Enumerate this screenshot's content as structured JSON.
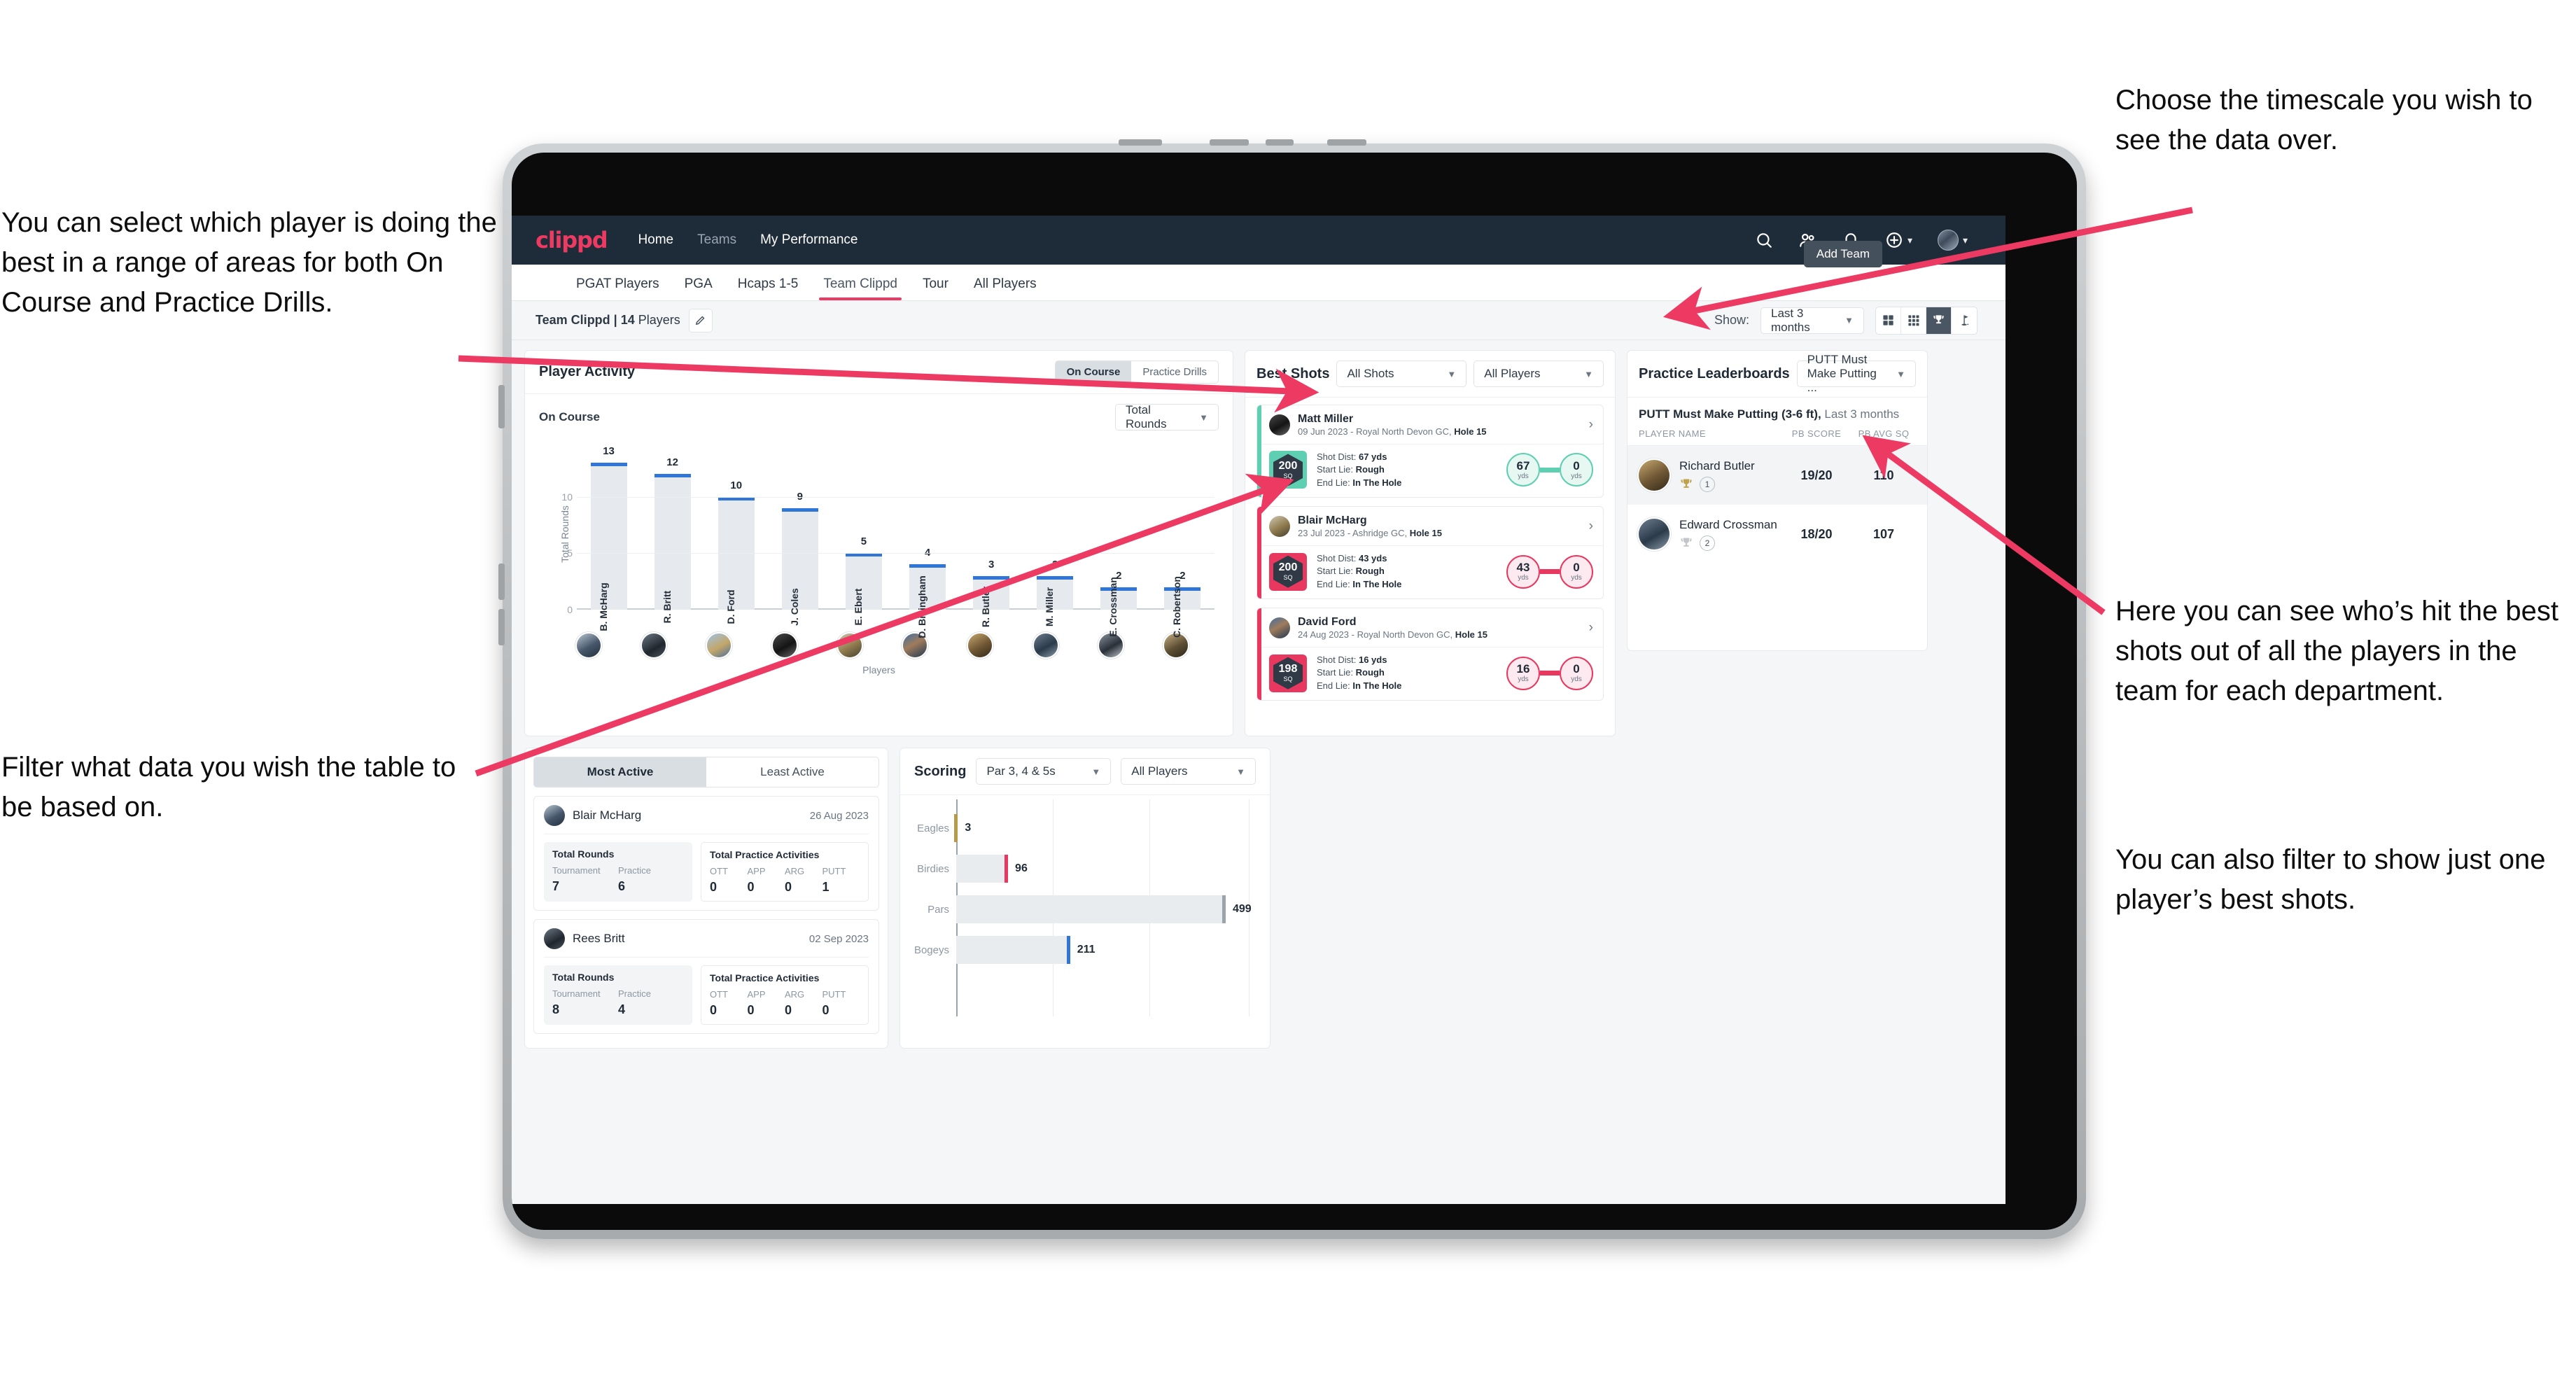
{
  "annotations": {
    "left_top": "You can select which player is doing the best in a range of areas for both On Course and Practice Drills.",
    "left_bottom": "Filter what data you wish the table to be based on.",
    "right_top": "Choose the timescale you wish to see the data over.",
    "right_mid": "Here you can see who’s hit the best shots out of all the players in the team for each department.",
    "right_bottom": "You can also filter to show just one player’s best shots."
  },
  "app": {
    "brand": "clippd",
    "nav_links": [
      {
        "label": "Home",
        "active": true
      },
      {
        "label": "Teams",
        "active": false
      },
      {
        "label": "My Performance",
        "active": true
      }
    ],
    "nav_icons": [
      "search-icon",
      "people-icon",
      "bell-icon",
      "plus-circle-icon",
      "avatar"
    ],
    "tabs": [
      {
        "label": "PGAT Players",
        "active": false
      },
      {
        "label": "PGA",
        "active": false
      },
      {
        "label": "Hcaps 1-5",
        "active": false
      },
      {
        "label": "Team Clippd",
        "active": true
      },
      {
        "label": "Tour",
        "active": false
      },
      {
        "label": "All Players",
        "active": false
      }
    ],
    "add_team_tooltip": "Add Team",
    "team_label_bold": "Team Clippd | 14",
    "team_label_rest": " Players",
    "show_label": "Show:",
    "show_value": "Last 3 months",
    "view_toggles": [
      {
        "icon": "grid-4-icon",
        "active": false
      },
      {
        "icon": "grid-9-icon",
        "active": false
      },
      {
        "icon": "trophy-icon",
        "active": true
      },
      {
        "icon": "golf-flag-icon",
        "active": false
      }
    ]
  },
  "player_activity": {
    "title": "Player Activity",
    "segments": [
      {
        "label": "On Course",
        "active": true
      },
      {
        "label": "Practice Drills",
        "active": false
      }
    ],
    "sub_label": "On Course",
    "metric_select": "Total Rounds",
    "x_axis_label": "Players"
  },
  "best_shots": {
    "title": "Best Shots",
    "filter_shots": "All Shots",
    "filter_players": "All Players",
    "shots": [
      {
        "player": "Matt Miller",
        "meta_plain": "09 Jun 2023 - Royal North Devon GC, ",
        "meta_bold": "Hole 15",
        "badge_value": "200",
        "badge_unit": "SQ",
        "shot_dist_label": "Shot Dist: ",
        "shot_dist": "67 yds",
        "start_lie_label": "Start Lie: ",
        "start_lie": "Rough",
        "end_lie_label": "End Lie: ",
        "end_lie": "In The Hole",
        "from_value": "67",
        "from_unit": "yds",
        "to_value": "0",
        "to_unit": "yds",
        "accent": "#5ecfb1"
      },
      {
        "player": "Blair McHarg",
        "meta_plain": "23 Jul 2023 - Ashridge GC, ",
        "meta_bold": "Hole 15",
        "badge_value": "200",
        "badge_unit": "SQ",
        "shot_dist_label": "Shot Dist: ",
        "shot_dist": "43 yds",
        "start_lie_label": "Start Lie: ",
        "start_lie": "Rough",
        "end_lie_label": "End Lie: ",
        "end_lie": "In The Hole",
        "from_value": "43",
        "from_unit": "yds",
        "to_value": "0",
        "to_unit": "yds",
        "accent": "#e8385f"
      },
      {
        "player": "David Ford",
        "meta_plain": "24 Aug 2023 - Royal North Devon GC, ",
        "meta_bold": "Hole 15",
        "badge_value": "198",
        "badge_unit": "SQ",
        "shot_dist_label": "Shot Dist: ",
        "shot_dist": "16 yds",
        "start_lie_label": "Start Lie: ",
        "start_lie": "Rough",
        "end_lie_label": "End Lie: ",
        "end_lie": "In The Hole",
        "from_value": "16",
        "from_unit": "yds",
        "to_value": "0",
        "to_unit": "yds",
        "accent": "#e8385f"
      }
    ]
  },
  "practice_leaderboards": {
    "title": "Practice Leaderboards",
    "drill_select": "PUTT Must Make Putting ...",
    "subtitle_bold": "PUTT Must Make Putting (3-6 ft),",
    "subtitle_rest": " Last 3 months",
    "columns": [
      "PLAYER NAME",
      "PB SCORE",
      "PB AVG SQ"
    ],
    "rows": [
      {
        "name": "Richard Butler",
        "rank": "1",
        "medal": "gold",
        "pb_score": "19/20",
        "pb_avg_sq": "110"
      },
      {
        "name": "Edward Crossman",
        "rank": "2",
        "medal": "silver",
        "pb_score": "18/20",
        "pb_avg_sq": "107"
      }
    ]
  },
  "activity_panel": {
    "tabs": [
      {
        "label": "Most Active",
        "active": true
      },
      {
        "label": "Least Active",
        "active": false
      }
    ],
    "rounds_title": "Total Rounds",
    "practice_title": "Total Practice Activities",
    "rounds_cols": [
      "Tournament",
      "Practice"
    ],
    "practice_cols": [
      "OTT",
      "APP",
      "ARG",
      "PUTT"
    ],
    "entries": [
      {
        "name": "Blair McHarg",
        "date": "26 Aug 2023",
        "tournament": "7",
        "practice": "6",
        "ott": "0",
        "app": "0",
        "arg": "0",
        "putt": "1"
      },
      {
        "name": "Rees Britt",
        "date": "02 Sep 2023",
        "tournament": "8",
        "practice": "4",
        "ott": "0",
        "app": "0",
        "arg": "0",
        "putt": "0"
      }
    ]
  },
  "scoring": {
    "title": "Scoring",
    "filter_par": "Par 3, 4 & 5s",
    "filter_players": "All Players"
  },
  "chart_data": [
    {
      "type": "bar",
      "title": "Player Activity - On Course",
      "xlabel": "Players",
      "ylabel": "Total Rounds",
      "categories": [
        "B. McHarg",
        "R. Britt",
        "D. Ford",
        "J. Coles",
        "E. Ebert",
        "D. Billingham",
        "R. Butler",
        "M. Miller",
        "E. Crossman",
        "C. Robertson"
      ],
      "values": [
        13,
        12,
        10,
        9,
        5,
        4,
        3,
        3,
        2,
        2
      ],
      "ylim": [
        0,
        14
      ],
      "yticks": [
        0,
        5,
        10
      ],
      "bar_color": "#e6e9ed",
      "cap_color": "#2f76d8",
      "grid": true,
      "legend": "none"
    },
    {
      "type": "bar",
      "orientation": "horizontal",
      "title": "Scoring",
      "categories": [
        "Eagles",
        "Birdies",
        "Pars",
        "Bogeys"
      ],
      "values": [
        3,
        96,
        499,
        211
      ],
      "xlim": [
        0,
        560
      ],
      "colors": [
        "#b89a4a",
        "#e8385f",
        "#9aa4af",
        "#2f76d8"
      ],
      "grid": true,
      "legend": "none"
    }
  ]
}
